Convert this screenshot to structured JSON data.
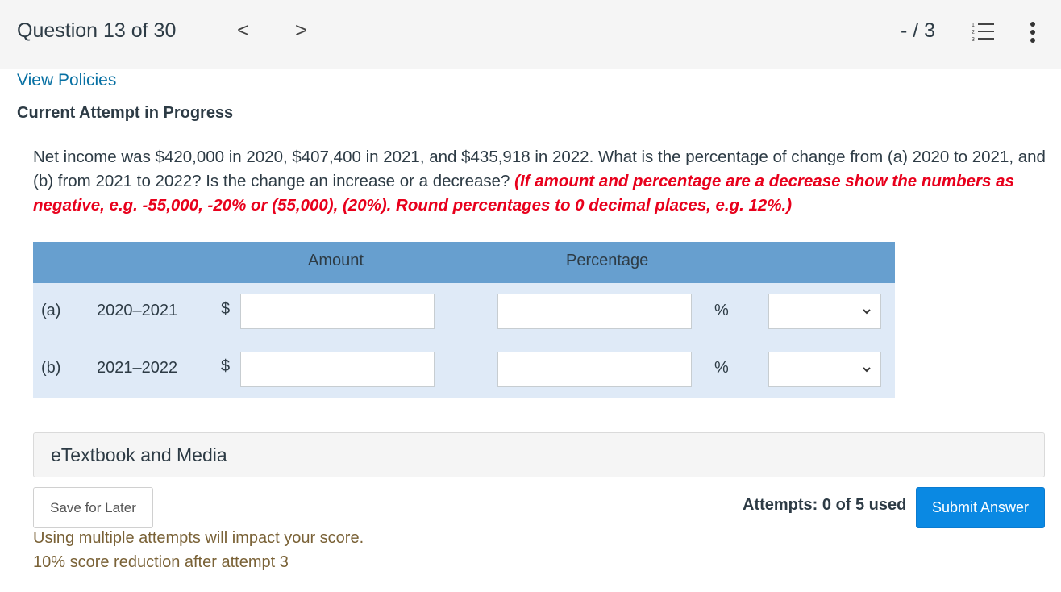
{
  "header": {
    "question_title": "Question 13 of 30",
    "prev_glyph": "<",
    "next_glyph": ">",
    "score": "- / 3"
  },
  "links": {
    "view_policies": "View Policies"
  },
  "attempt_title": "Current Attempt in Progress",
  "question": {
    "text": "Net income was $420,000 in 2020, $407,400 in 2021, and $435,918 in 2022. What is the percentage of change from (a) 2020 to 2021, and (b) from 2021 to 2022? Is the change an increase or a decrease? ",
    "instruction": "(If amount and percentage are a decrease show the numbers as negative, e.g. -55,000, -20% or (55,000), (20%). Round percentages to 0 decimal places, e.g. 12%.)"
  },
  "table": {
    "headers": {
      "amount": "Amount",
      "percentage": "Percentage"
    },
    "rows": [
      {
        "label": "(a)",
        "period": "2020–2021",
        "currency": "$",
        "amount_value": "",
        "percent_value": "",
        "percent_sign": "%",
        "direction_selected": ""
      },
      {
        "label": "(b)",
        "period": "2021–2022",
        "currency": "$",
        "amount_value": "",
        "percent_value": "",
        "percent_sign": "%",
        "direction_selected": ""
      }
    ]
  },
  "etextbook": {
    "label": "eTextbook and Media"
  },
  "footer": {
    "save_label": "Save for Later",
    "attempts": "Attempts: 0 of 5 used",
    "submit_label": "Submit Answer",
    "warning_line1": "Using multiple attempts will impact your score.",
    "warning_line2": "10% score reduction after attempt 3"
  },
  "colors": {
    "accent_blue": "#0a89e3",
    "link_blue": "#0770a3",
    "table_header": "#679fcf",
    "table_row": "#dfeaf7",
    "instruction_red": "#e8001c",
    "warning_brown": "#7a6237"
  },
  "icons": {
    "prev": "chevron-left-icon",
    "next": "chevron-right-icon",
    "list": "numbered-list-icon",
    "more": "more-vertical-icon",
    "select": "chevron-down-icon"
  }
}
